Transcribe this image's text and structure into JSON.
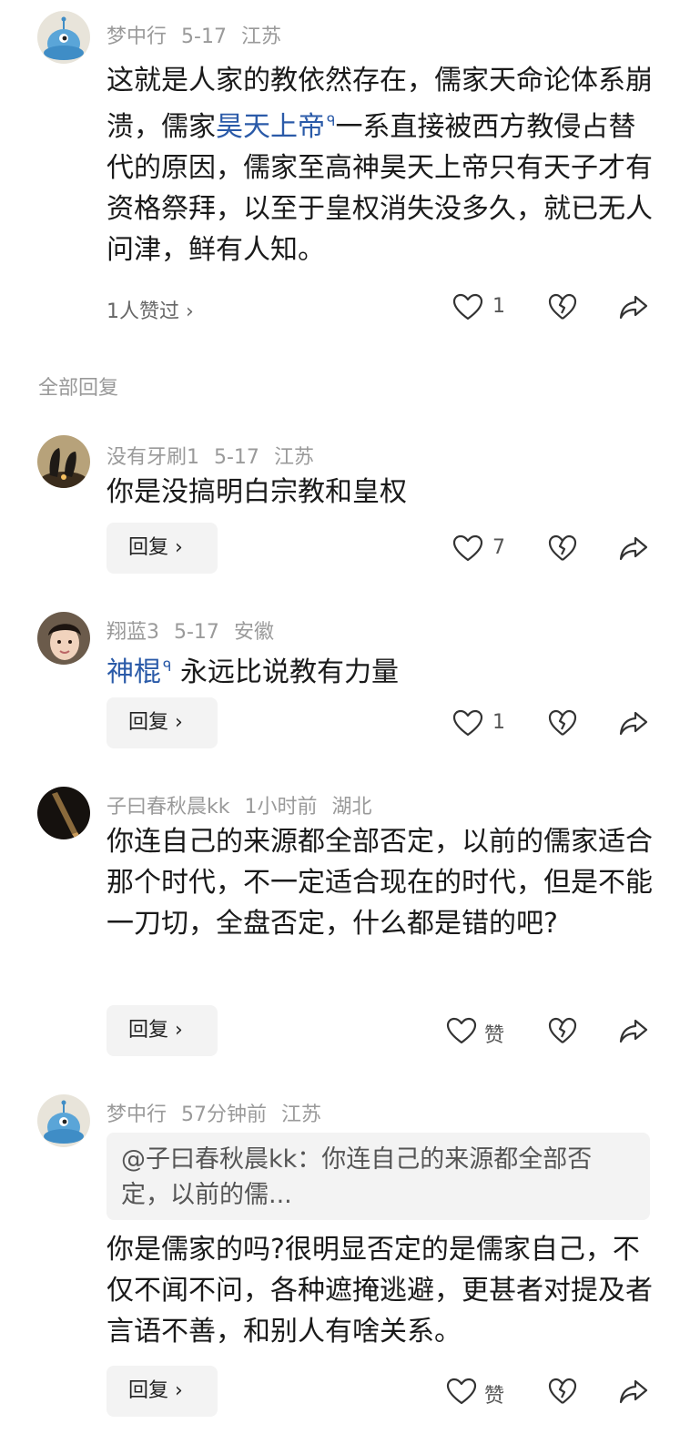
{
  "colors": {
    "link": "#2a5aa8",
    "meta": "#9a9a9a",
    "reply_bg": "#f3f3f3"
  },
  "main_comment": {
    "author": "梦中行",
    "date": "5-17",
    "location": "江苏",
    "text_a": "这就是人家的教依然存在，儒家天命论体系崩溃，儒家",
    "link": "昊天上帝",
    "text_b": "一系直接被西方教侵占替代的原因，儒家至高神昊天上帝只有天子才有资格祭拜，以至于皇权消失没多久，就已无人问津，鲜有人知。",
    "liked_by": "1人赞过 ›",
    "likes": "1"
  },
  "section_title": "全部回复",
  "replies": [
    {
      "author": "没有牙刷1",
      "date": "5-17",
      "location": "江苏",
      "text": "你是没搞明白宗教和皇权",
      "reply_label": "回复 ›",
      "likes": "7"
    },
    {
      "author": "翔蓝3",
      "date": "5-17",
      "location": "安徽",
      "link": "神棍",
      "text": " 永远比说教有力量",
      "reply_label": "回复 ›",
      "likes": "1"
    },
    {
      "author": "子曰春秋晨kk",
      "date": "1小时前",
      "location": "湖北",
      "text": "你连自己的来源都全部否定，以前的儒家适合那个时代，不一定适合现在的时代，但是不能一刀切，全盘否定，什么都是错的吧?",
      "reply_label": "回复 ›",
      "likes": "赞"
    },
    {
      "author": "梦中行",
      "date": "57分钟前",
      "location": "江苏",
      "quote": "@子曰春秋晨kk：你连自己的来源都全部否定，以前的儒...",
      "text": "你是儒家的吗?很明显否定的是儒家自己，不仅不闻不问，各种遮掩逃避，更甚者对提及者言语不善，和别人有啥关系。",
      "reply_label": "回复 ›",
      "likes": "赞"
    }
  ],
  "icons": {
    "like": "heart-outline-icon",
    "dislike": "broken-heart-icon",
    "share": "share-arrow-icon"
  }
}
